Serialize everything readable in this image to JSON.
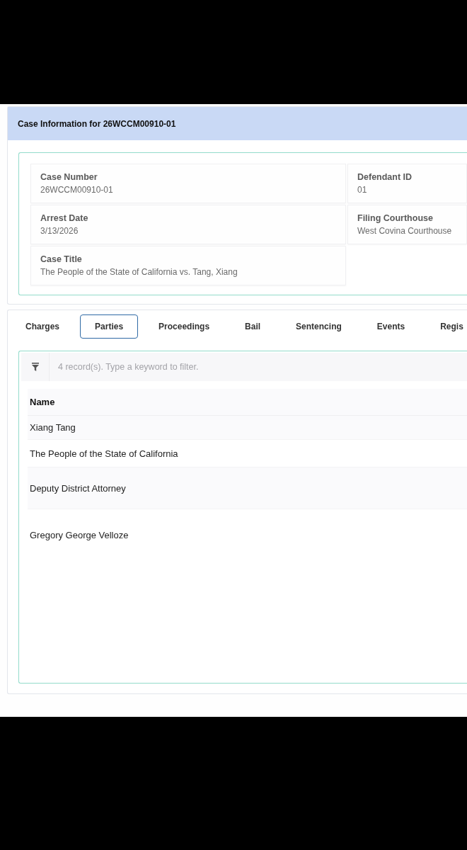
{
  "header": {
    "title": "Case Information for 26WCCM00910-01"
  },
  "case_fields": [
    {
      "label": "Case Number",
      "value": "26WCCM00910-01"
    },
    {
      "label": "Defendant ID",
      "value": "01"
    },
    {
      "label": "Arrest Date",
      "value": "3/13/2026"
    },
    {
      "label": "Filing Courthouse",
      "value": "West Covina Courthouse"
    },
    {
      "label": "Case Title",
      "value": "The People of the State of California vs. Tang, Xiang"
    }
  ],
  "tabs": [
    {
      "label": "Charges",
      "selected": false
    },
    {
      "label": "Parties",
      "selected": true
    },
    {
      "label": "Proceedings",
      "selected": false
    },
    {
      "label": "Bail",
      "selected": false
    },
    {
      "label": "Sentencing",
      "selected": false
    },
    {
      "label": "Events",
      "selected": false
    },
    {
      "label": "Regis",
      "selected": false
    }
  ],
  "filter": {
    "placeholder": "4 record(s). Type a keyword to filter."
  },
  "table": {
    "columns": [
      "Name"
    ],
    "rows": [
      [
        "Xiang Tang"
      ],
      [
        "The People of the State of California"
      ],
      [
        "Deputy District Attorney"
      ],
      [
        "Gregory George Velloze"
      ]
    ]
  }
}
